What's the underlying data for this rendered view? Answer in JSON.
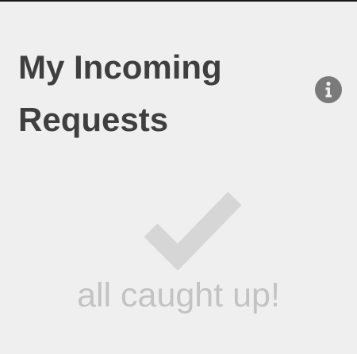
{
  "header": {
    "title": "My Incoming Requests",
    "info_icon": "info-icon"
  },
  "empty_state": {
    "icon": "checkmark-icon",
    "message": "all caught up!"
  },
  "colors": {
    "background": "#efefef",
    "title": "#3f3f3f",
    "info_icon_bg": "#7a7a7a",
    "checkmark": "#d6d6d6",
    "empty_text": "#c3c3c3"
  }
}
